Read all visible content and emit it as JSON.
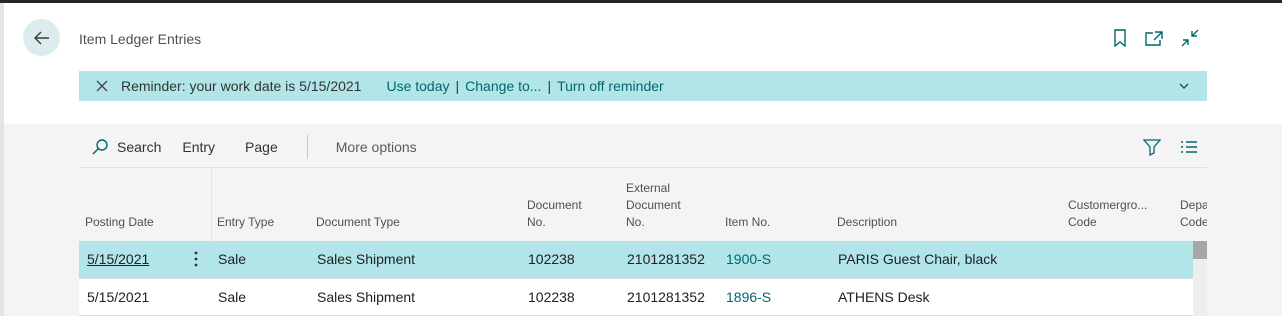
{
  "header": {
    "title": "Item Ledger Entries",
    "icons": [
      "back-arrow-icon",
      "bookmark-icon",
      "open-new-window-icon",
      "collapse-icon"
    ]
  },
  "reminder": {
    "text": "Reminder: your work date is 5/15/2021",
    "use_today": "Use today",
    "change_to": "Change to...",
    "turn_off": "Turn off reminder",
    "separator": "|",
    "icons": [
      "close-icon",
      "chevron-down-icon"
    ]
  },
  "toolbar": {
    "search": "Search",
    "entry": "Entry",
    "page": "Page",
    "more_options": "More options",
    "icons": [
      "search-icon",
      "filter-icon",
      "list-view-icon"
    ]
  },
  "columns": [
    {
      "line1": "",
      "line2": "",
      "line3": "Posting Date"
    },
    {
      "line1": "",
      "line2": "",
      "line3": "Entry Type"
    },
    {
      "line1": "",
      "line2": "",
      "line3": "Document Type"
    },
    {
      "line1": "",
      "line2": "Document",
      "line3": "No."
    },
    {
      "line1": "External",
      "line2": "Document",
      "line3": "No."
    },
    {
      "line1": "",
      "line2": "",
      "line3": "Item No."
    },
    {
      "line1": "",
      "line2": "",
      "line3": "Description"
    },
    {
      "line1": "",
      "line2": "Customergro...",
      "line3": "Code"
    },
    {
      "line1": "",
      "line2": "Depa",
      "line3": "Code"
    }
  ],
  "rows": [
    {
      "posting_date": "5/15/2021",
      "entry_type": "Sale",
      "document_type": "Sales Shipment",
      "document_no": "102238",
      "external_document_no": "2101281352",
      "item_no": "1900-S",
      "description": "PARIS Guest Chair, black",
      "selected": true
    },
    {
      "posting_date": "5/15/2021",
      "entry_type": "Sale",
      "document_type": "Sales Shipment",
      "document_no": "102238",
      "external_document_no": "2101281352",
      "item_no": "1896-S",
      "description": "ATHENS Desk",
      "selected": false
    }
  ],
  "colors": {
    "accent": "#00676e",
    "reminder_bg": "#b2e5e8",
    "selected_row": "#b2e5e8"
  }
}
